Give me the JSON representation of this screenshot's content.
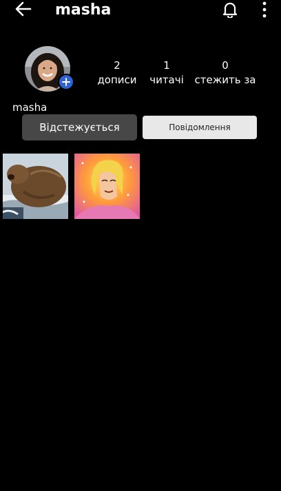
{
  "header": {
    "title": "masha",
    "back_icon": "arrow-left-icon",
    "bell_icon": "bell-icon",
    "more_icon": "more-vertical-icon"
  },
  "profile": {
    "username": "masha",
    "add_icon": "plus-icon",
    "stats": [
      {
        "value": "2",
        "label": "дописи"
      },
      {
        "value": "1",
        "label": "читачі"
      },
      {
        "value": "0",
        "label": "стежить за"
      }
    ]
  },
  "actions": {
    "following_label": "Відстежується",
    "message_label": "Повідомлення"
  },
  "posts": [
    {
      "subject": "beaver"
    },
    {
      "subject": "he-man"
    }
  ],
  "colors": {
    "background": "#000000",
    "following_button": "#474747",
    "message_button": "#e8e8e8",
    "add_badge": "#2f62d2"
  }
}
